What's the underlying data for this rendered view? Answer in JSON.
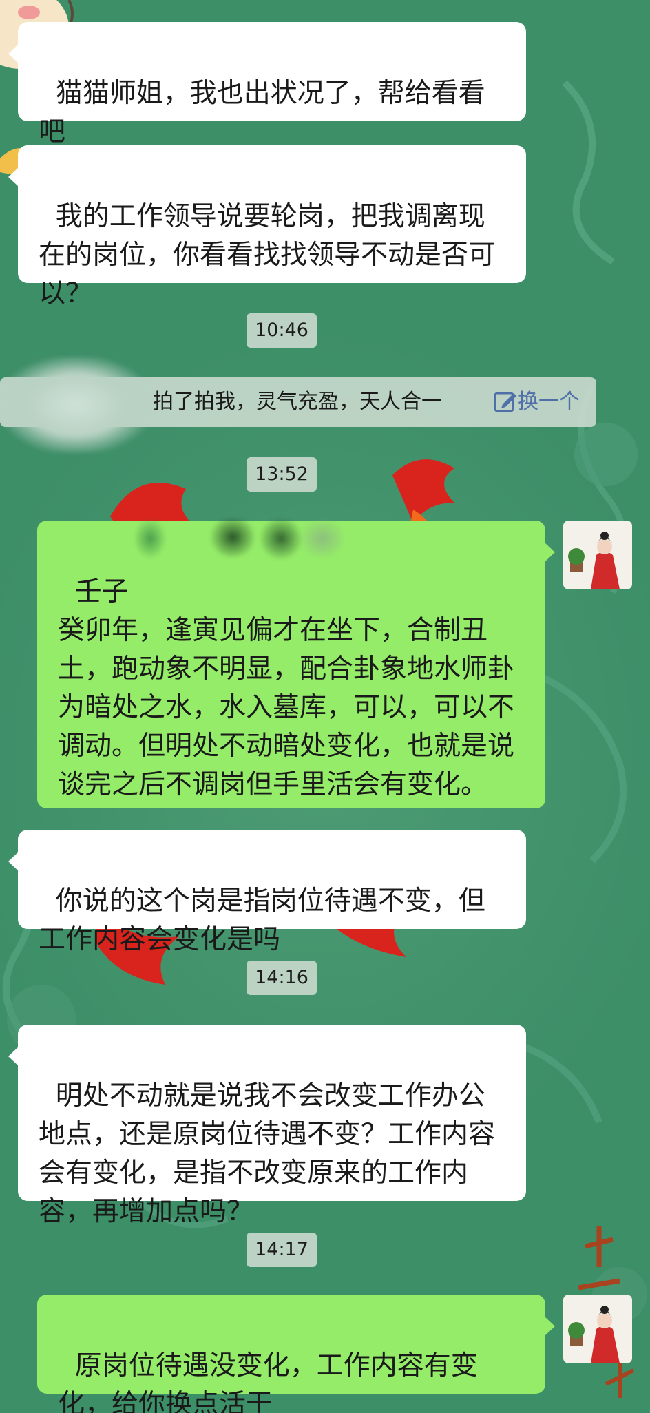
{
  "chat": {
    "messages": [
      {
        "side": "left",
        "text": "猫猫师姐，我也出状况了，帮给看看吧"
      },
      {
        "side": "left",
        "text": "我的工作领导说要轮岗，把我调离现在的岗位，你看看找找领导不动是否可以？"
      },
      {
        "side": "right",
        "text": "壬子\n癸卯年，逢寅见偏才在坐下，合制丑土，跑动象不明显，配合卦象地水师卦为暗处之水，水入墓库，可以，可以不调动。但明处不动暗处变化，也就是说谈完之后不调岗但手里活会有变化。"
      },
      {
        "side": "left",
        "text": "你说的这个岗是指岗位待遇不变，但工作内容会变化是吗"
      },
      {
        "side": "left",
        "text": "明处不动就是说我不会改变工作办公地点，还是原岗位待遇不变？工作内容会有变化，是指不改变原来的工作内容，再增加点吗？"
      },
      {
        "side": "right",
        "text": "原岗位待遇没变化，工作内容有变化，给你换点活干"
      }
    ],
    "timestamps": [
      "10:46",
      "13:52",
      "14:16",
      "14:17"
    ],
    "pat_notice": {
      "text": "拍了拍我，灵气充盈，天人合一",
      "link": "换一个",
      "link_icon": "edit-icon"
    }
  },
  "colors": {
    "background": "#3d8f68",
    "incoming_bubble": "#ffffff",
    "outgoing_bubble": "#95ec69",
    "link": "#4f6fa8"
  }
}
